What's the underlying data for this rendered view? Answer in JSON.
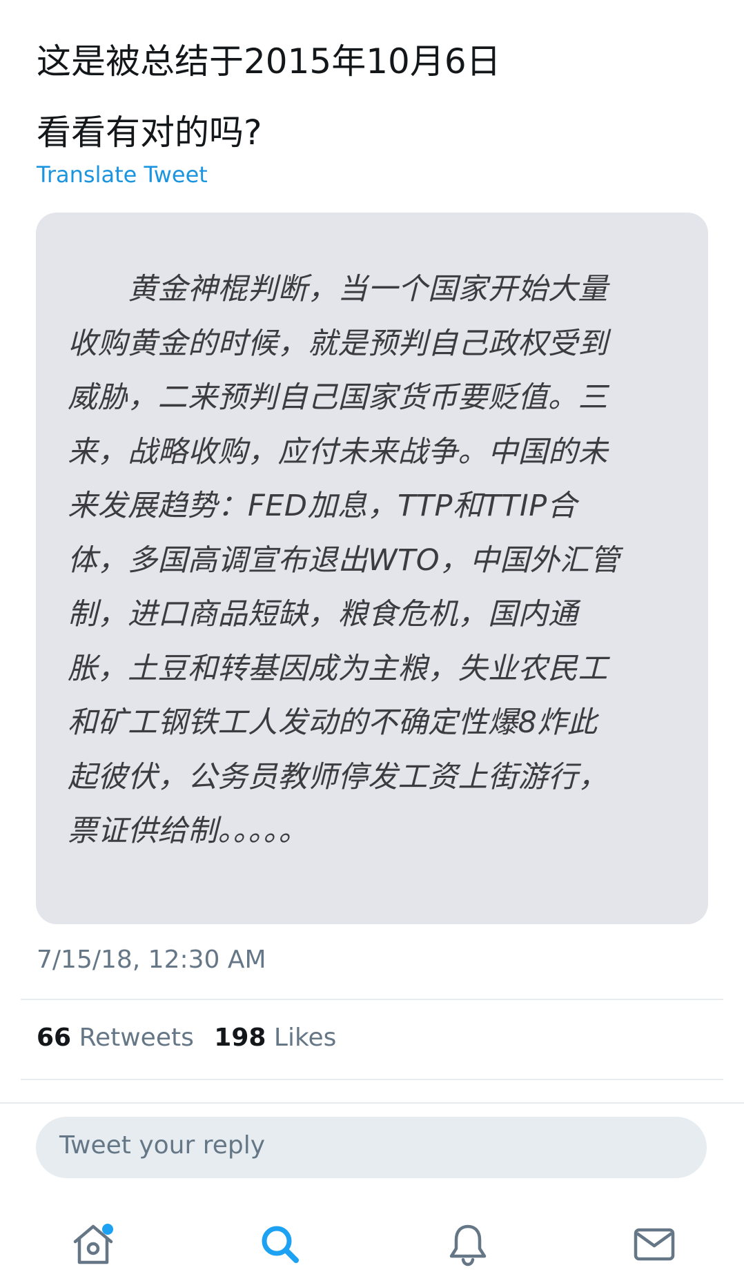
{
  "tweet": {
    "text_lines": [
      "这是被总结于2015年10月6日",
      "看看有对的吗?"
    ],
    "translate_label": "Translate Tweet",
    "image_text_lines": [
      "　　黄金神棍判断，当一个国家开始大量",
      "收购黄金的时候，就是预判自己政权受到",
      "威胁，二来预判自己国家货币要贬值。三",
      "来，战略收购，应付未来战争。中国的未",
      "来发展趋势：FED加息，TTP和TTIP合",
      "体，多国高调宣布退出WTO，中国外汇管",
      "制，进口商品短缺，粮食危机，国内通",
      "胀，土豆和转基因成为主粮，失业农民工",
      "和矿工钢铁工人发动的不确定性爆8炸此",
      "起彼伏，公务员教师停发工资上街游行，",
      "票证供给制。。。。。"
    ],
    "timestamp": "7/15/18, 12:30 AM",
    "retweets_count": "66",
    "retweets_label": "Retweets",
    "likes_count": "198",
    "likes_label": "Likes"
  },
  "reply": {
    "placeholder": "Tweet your reply"
  },
  "tab_bar": {
    "tabs": [
      {
        "icon": "home-icon",
        "active": false,
        "has_notification_dot": true
      },
      {
        "icon": "search-icon",
        "active": true
      },
      {
        "icon": "bell-icon",
        "active": false
      },
      {
        "icon": "mail-icon",
        "active": false
      }
    ]
  },
  "colors": {
    "link": "#1b95e0",
    "active_tab": "#1da1f2",
    "inactive_tab": "#657786",
    "secondary_text": "#657786",
    "card_background": "#e4e5ea"
  }
}
